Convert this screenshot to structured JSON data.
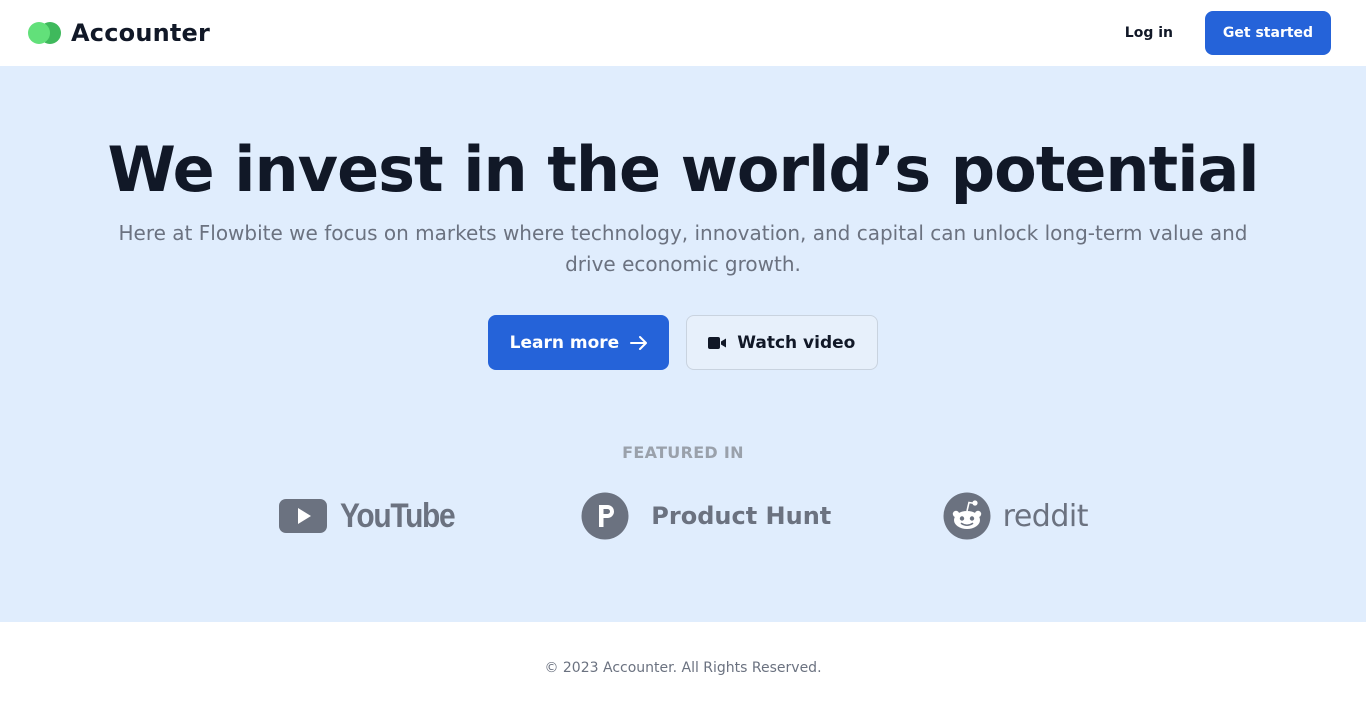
{
  "nav": {
    "brand": "Accounter",
    "login_label": "Log in",
    "get_started_label": "Get started"
  },
  "hero": {
    "title": "We invest in the world’s potential",
    "subtitle": "Here at Flowbite we focus on markets where technology, innovation, and capital can unlock long-term value and drive economic growth.",
    "learn_more_label": "Learn more",
    "watch_video_label": "Watch video"
  },
  "featured": {
    "label": "FEATURED IN",
    "logos": [
      {
        "name": "YouTube",
        "icon": "youtube-icon"
      },
      {
        "name": "Product Hunt",
        "icon": "product-hunt-icon"
      },
      {
        "name": "reddit",
        "icon": "reddit-icon"
      }
    ]
  },
  "footer": {
    "copyright": "© 2023 Accounter. All Rights Reserved."
  },
  "colors": {
    "accent": "#2563d9",
    "hero_background": "#e0edfd",
    "logo_gray": "#6b7280",
    "logo_green_light": "#62e07a",
    "logo_green_dark": "#3fb95c"
  }
}
